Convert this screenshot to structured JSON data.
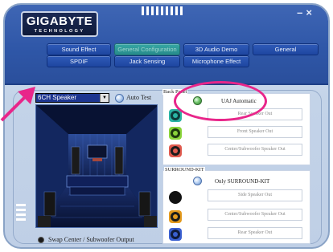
{
  "brand": {
    "logo_main": "GIGABYTE",
    "logo_sub": "TECHNOLOGY"
  },
  "window_controls": {
    "minimize": "–",
    "close": "×"
  },
  "tabs": [
    {
      "label": "Sound Effect",
      "active": false
    },
    {
      "label": "General Configuration",
      "active": true
    },
    {
      "label": "3D Audio Demo",
      "active": false
    },
    {
      "label": "General",
      "active": false
    },
    {
      "label": "SPDIF",
      "active": false
    },
    {
      "label": "Jack Sensing",
      "active": false
    },
    {
      "label": "Microphone Effect",
      "active": false
    }
  ],
  "speaker_config": {
    "selected": "6CH Speaker",
    "auto_test_label": "Auto Test"
  },
  "swap_option": {
    "label": "Swap Center / Subwoofer Output"
  },
  "back_panel": {
    "caption": "Back Panel",
    "uaj_label": "UAJ Automatic",
    "outputs": [
      {
        "label": "Rear Speaker Out",
        "jack_color": "#2ab4a4"
      },
      {
        "label": "Front Speaker Out",
        "jack_color": "#8ad43a"
      },
      {
        "label": "Center/Subwoofer Speaker Out",
        "jack_color": "#e05a4e"
      }
    ]
  },
  "surround_kit": {
    "caption": "SURROUND-KIT",
    "only_label": "Only SURROUND-KIT",
    "outputs": [
      {
        "label": "Side Speaker Out",
        "jack_color": "#111111"
      },
      {
        "label": "Center/Subwoofer Speaker Out",
        "jack_color": "#e39a1e"
      },
      {
        "label": "Rear Speaker Out",
        "jack_color": "#3a5fd0"
      }
    ]
  },
  "colors": {
    "header_blue": "#2f57a8",
    "active_tab_teal": "#278a8c",
    "annotation_pink": "#e8268a",
    "selection_blue": "#1d3590"
  }
}
